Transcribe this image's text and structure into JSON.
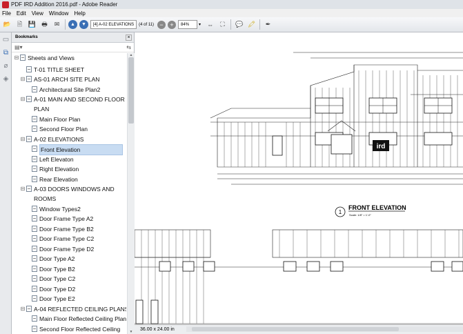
{
  "window": {
    "title": "PDF IRD Addition 2016.pdf - Adobe Reader"
  },
  "menu": [
    "File",
    "Edit",
    "View",
    "Window",
    "Help"
  ],
  "toolbar": {
    "page_field": "[4] A-02 ELEVATIONS",
    "page_count": "(4 of 11)",
    "zoom": "84%"
  },
  "panel": {
    "header": "Bookmarks"
  },
  "bookmarks": [
    {
      "label": "Sheets and Views",
      "level": 0,
      "toggle": "⊟"
    },
    {
      "label": "T-01 TITLE SHEET",
      "level": 1,
      "toggle": ""
    },
    {
      "label": "AS-01 ARCH SITE PLAN",
      "level": 1,
      "toggle": "⊟"
    },
    {
      "label": "Architectural Site Plan2",
      "level": 2,
      "toggle": ""
    },
    {
      "label": "A-01 MAIN AND SECOND FLOOR PLAN",
      "level": 1,
      "toggle": "⊟"
    },
    {
      "label": "Main Floor Plan",
      "level": 2,
      "toggle": ""
    },
    {
      "label": "Second Floor Plan",
      "level": 2,
      "toggle": ""
    },
    {
      "label": "A-02 ELEVATIONS",
      "level": 1,
      "toggle": "⊟"
    },
    {
      "label": "Front Elevation",
      "level": 2,
      "toggle": "",
      "selected": true
    },
    {
      "label": "Left Elevaton",
      "level": 2,
      "toggle": ""
    },
    {
      "label": "Right Elevation",
      "level": 2,
      "toggle": ""
    },
    {
      "label": "Rear Elevation",
      "level": 2,
      "toggle": ""
    },
    {
      "label": "A-03 DOORS WINDOWS AND ROOMS",
      "level": 1,
      "toggle": "⊟"
    },
    {
      "label": "Window Types2",
      "level": 2,
      "toggle": ""
    },
    {
      "label": "Door Frame Type A2",
      "level": 2,
      "toggle": ""
    },
    {
      "label": "Door Frame Type B2",
      "level": 2,
      "toggle": ""
    },
    {
      "label": "Door Frame Type C2",
      "level": 2,
      "toggle": ""
    },
    {
      "label": "Door Frame Type D2",
      "level": 2,
      "toggle": ""
    },
    {
      "label": "Door Type A2",
      "level": 2,
      "toggle": ""
    },
    {
      "label": "Door Type B2",
      "level": 2,
      "toggle": ""
    },
    {
      "label": "Door Type C2",
      "level": 2,
      "toggle": ""
    },
    {
      "label": "Door Type D2",
      "level": 2,
      "toggle": ""
    },
    {
      "label": "Door Type E2",
      "level": 2,
      "toggle": ""
    },
    {
      "label": "A-04 REFLECTED CEILING PLANS",
      "level": 1,
      "toggle": "⊟"
    },
    {
      "label": "Main Floor Reflected Ceiling Plan",
      "level": 2,
      "toggle": ""
    },
    {
      "label": "Second Floor Reflected Ceiling Pl...",
      "level": 2,
      "toggle": ""
    }
  ],
  "drawing": {
    "view_number": "1",
    "view_title": "FRONT ELEVATION",
    "scale": "Scale: 1/8\" = 1'-0\"",
    "sign_text": "ird"
  },
  "status": {
    "page_size": "36.00 x 24.00 in"
  }
}
